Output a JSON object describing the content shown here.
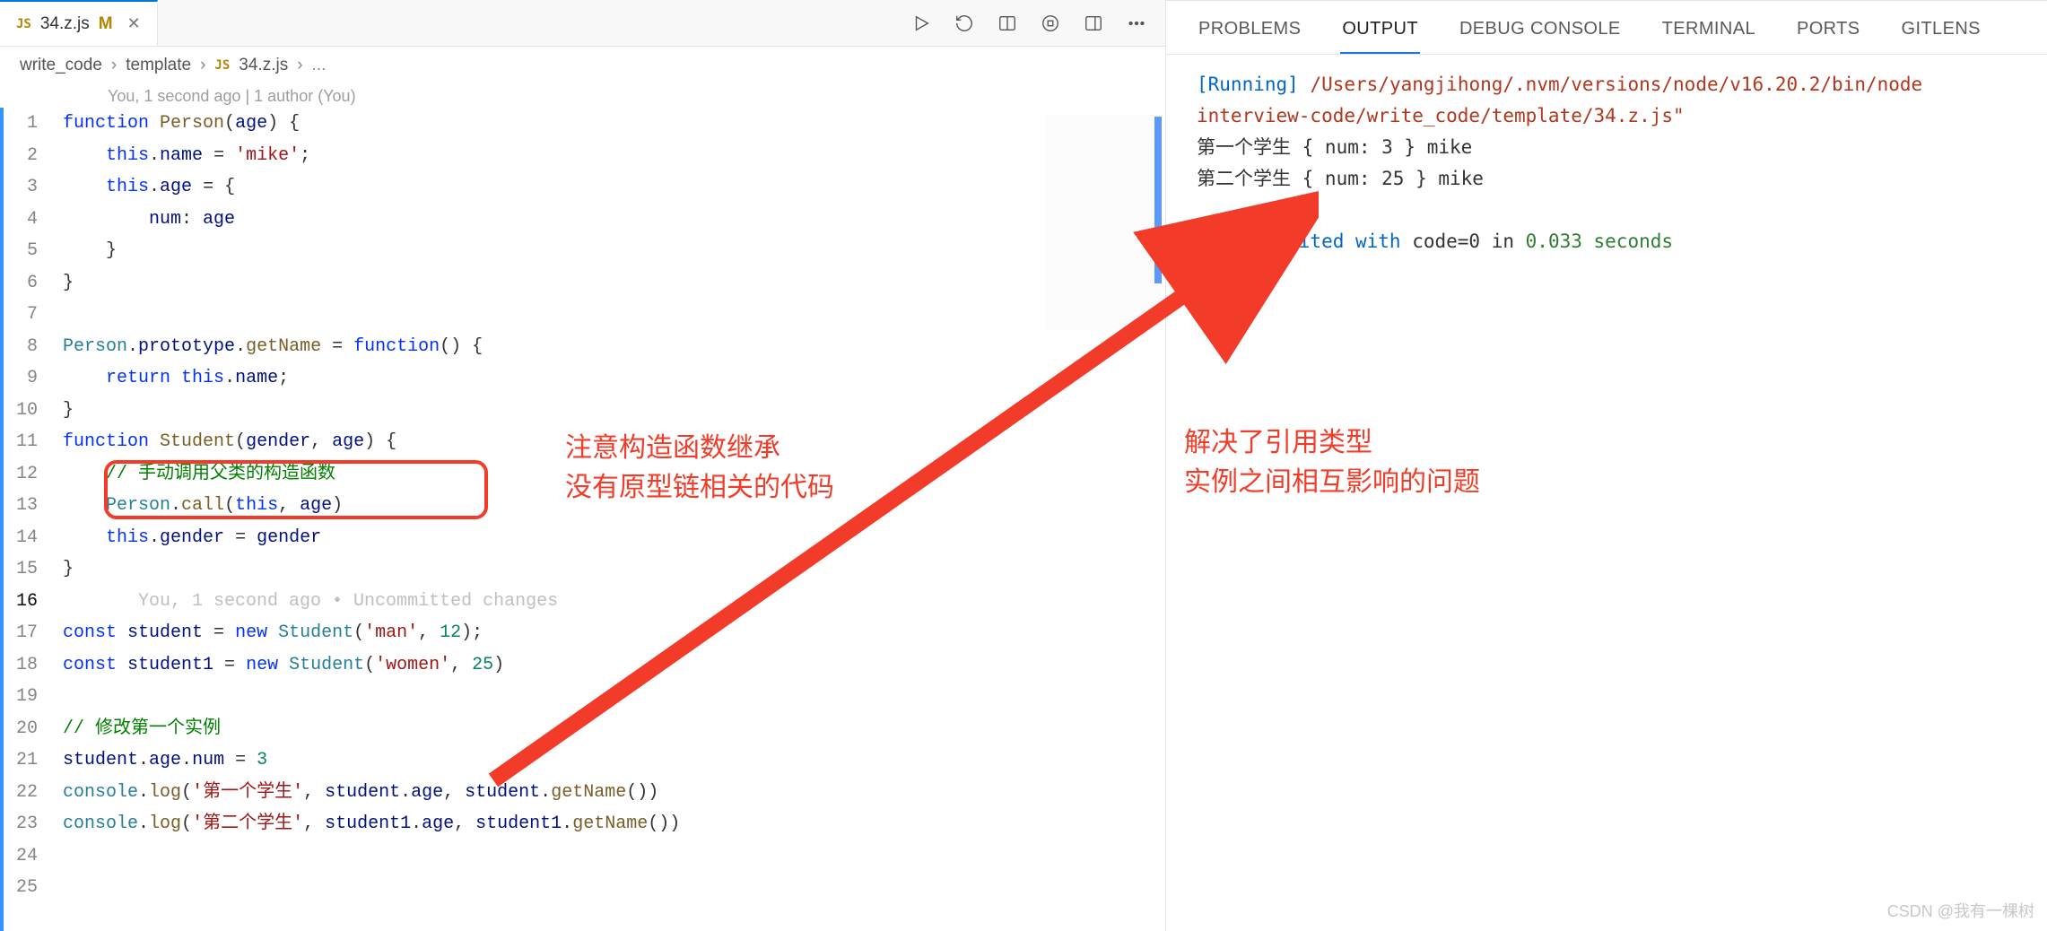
{
  "tab": {
    "icon": "JS",
    "filename": "34.z.js",
    "status": "M"
  },
  "toolbar": {
    "run_icon": "run",
    "debug_icon": "debug",
    "split_h_icon": "split-h",
    "stop_icon": "stop",
    "layout_icon": "layout",
    "more_icon": "more"
  },
  "breadcrumb": {
    "p1": "write_code",
    "p2": "template",
    "icon": "JS",
    "p3": "34.z.js",
    "p4": "..."
  },
  "blame": "You, 1 second ago | 1 author (You)",
  "code": {
    "l1": "function Person(age) {",
    "l2": "    this.name = 'mike';",
    "l3": "    this.age = {",
    "l4": "        num: age",
    "l5": "    }",
    "l6": "}",
    "l7": "",
    "l8": "Person.prototype.getName = function() {",
    "l9": "    return this.name;",
    "l10": "}",
    "l11": "function Student(gender, age) {",
    "l12": "    // 手动调用父类的构造函数",
    "l13": "    Person.call(this, age)",
    "l14": "    this.gender = gender",
    "l15": "}",
    "l16_blame": "       You, 1 second ago • Uncommitted changes",
    "l17": "const student = new Student('man', 12);",
    "l18": "const student1 = new Student('women', 25)",
    "l19": "",
    "l20": "// 修改第一个实例",
    "l21": "student.age.num = 3",
    "l22": "console.log('第一个学生', student.age, student.getName())",
    "l23": "console.log('第二个学生', student1.age, student1.getName())",
    "l24": "",
    "l25": ""
  },
  "annotations": {
    "left_line1": "注意构造函数继承",
    "left_line2": "没有原型链相关的代码",
    "right_line1": "解决了引用类型",
    "right_line2": "实例之间相互影响的问题"
  },
  "panel_tabs": {
    "problems": "PROBLEMS",
    "output": "OUTPUT",
    "debug": "DEBUG CONSOLE",
    "terminal": "TERMINAL",
    "ports": "PORTS",
    "gitlens": "GITLENS"
  },
  "output": {
    "running_tag": "[Running]",
    "cmd": "/Users/yangjihong/.nvm/versions/node/v16.20.2/bin/node",
    "path2": "interview-code/write_code/template/34.z.js\"",
    "line1": "第一个学生 { num: 3 } mike",
    "line2": "第二个学生 { num: 25 } mike",
    "done_pre": "[Done] exited with ",
    "done_code": "code=0",
    "done_in": " in ",
    "done_time": "0.033 seconds"
  },
  "watermark": "CSDN @我有一棵树"
}
